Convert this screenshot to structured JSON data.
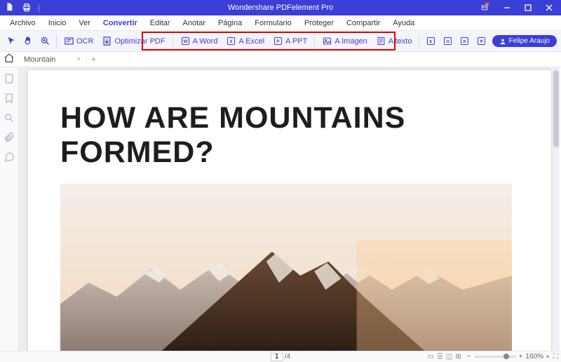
{
  "app": {
    "title": "Wondershare PDFelement Pro"
  },
  "menu": {
    "items": [
      "Archivo",
      "Inicio",
      "Ver",
      "Convertir",
      "Editar",
      "Anotar",
      "Página",
      "Formulario",
      "Proteger",
      "Compartir",
      "Ayuda"
    ],
    "active_index": 3
  },
  "toolbar": {
    "ocr": "OCR",
    "optimize": "Optimizar PDF",
    "to_word": "A Word",
    "to_excel": "A Excel",
    "to_ppt": "A PPT",
    "to_image": "A Imagen",
    "to_text": "A texto"
  },
  "user": {
    "name": "Felipe Araujo"
  },
  "tabs": {
    "items": [
      {
        "label": "Mountain"
      }
    ]
  },
  "document": {
    "heading": "HOW ARE MOUNTAINS FORMED?"
  },
  "status": {
    "page_current": "1",
    "page_total": "/4",
    "zoom_label": "160%"
  }
}
